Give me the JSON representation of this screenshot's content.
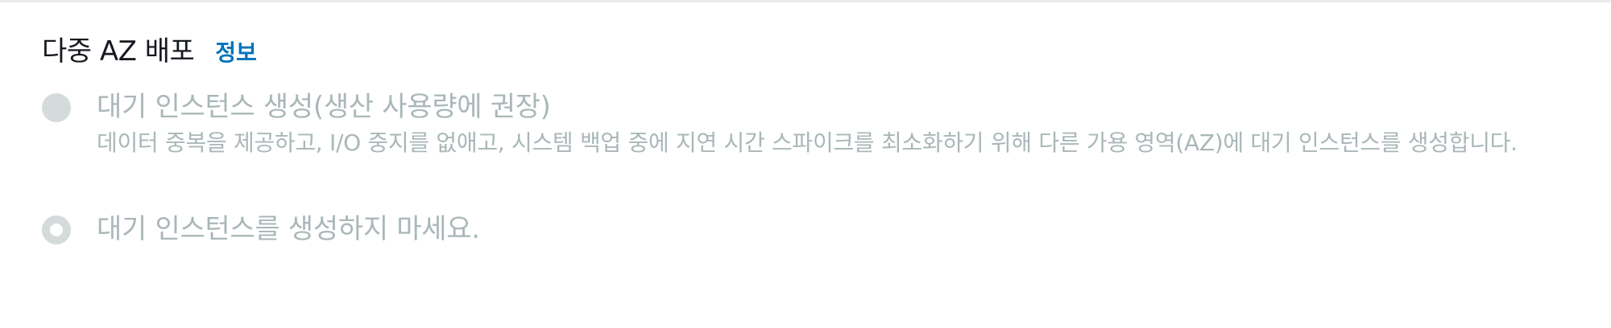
{
  "section": {
    "title": "다중 AZ 배포",
    "info_link": "정보"
  },
  "options": [
    {
      "label": "대기 인스턴스 생성(생산 사용량에 권장)",
      "description": "데이터 중복을 제공하고, I/O 중지를 없애고, 시스템 백업 중에 지연 시간 스파이크를 최소화하기 위해 다른 가용 영역(AZ)에 대기 인스턴스를 생성합니다.",
      "selected": false,
      "disabled": true
    },
    {
      "label": "대기 인스턴스를 생성하지 마세요.",
      "selected": true,
      "disabled": true
    }
  ],
  "colors": {
    "title": "#16191f",
    "link": "#0073bb",
    "disabled_text": "#aab7b8",
    "disabled_radio": "#d5dbdb"
  }
}
